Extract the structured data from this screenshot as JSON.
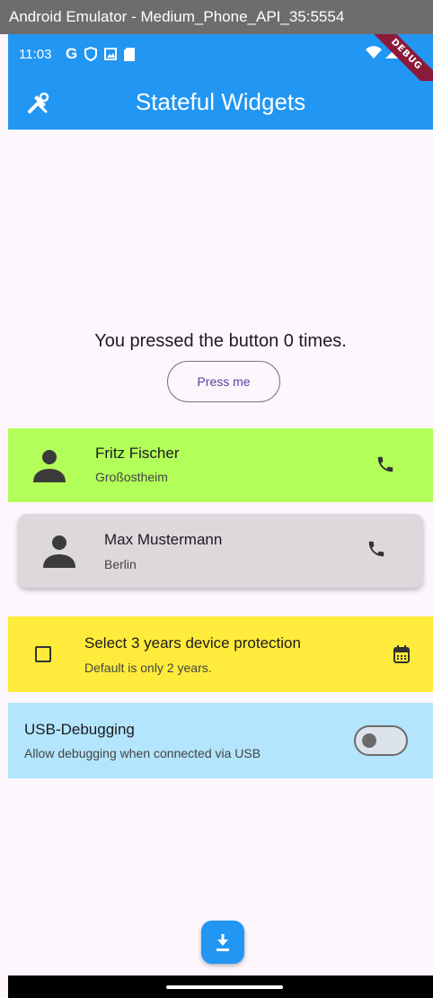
{
  "window": {
    "title": "Android Emulator - Medium_Phone_API_35:5554"
  },
  "status_bar": {
    "time": "11:03",
    "debug_banner": "DEBUG"
  },
  "app_bar": {
    "title": "Stateful Widgets"
  },
  "counter": {
    "text": "You pressed the button 0 times.",
    "button_label": "Press me"
  },
  "contacts": [
    {
      "name": "Fritz Fischer",
      "city": "Großostheim"
    },
    {
      "name": "Max Mustermann",
      "city": "Berlin"
    }
  ],
  "protection": {
    "title": "Select 3 years device protection",
    "subtitle": "Default is only 2 years.",
    "checked": false
  },
  "usb_debugging": {
    "title": "USB-Debugging",
    "subtitle": "Allow debugging when connected via USB",
    "enabled": false
  },
  "colors": {
    "primary": "#2196f3",
    "green_tile": "#b2ff59",
    "yellow_tile": "#ffeb3b",
    "blue_tile": "#b3e5fc",
    "background": "#fdf7fd"
  }
}
